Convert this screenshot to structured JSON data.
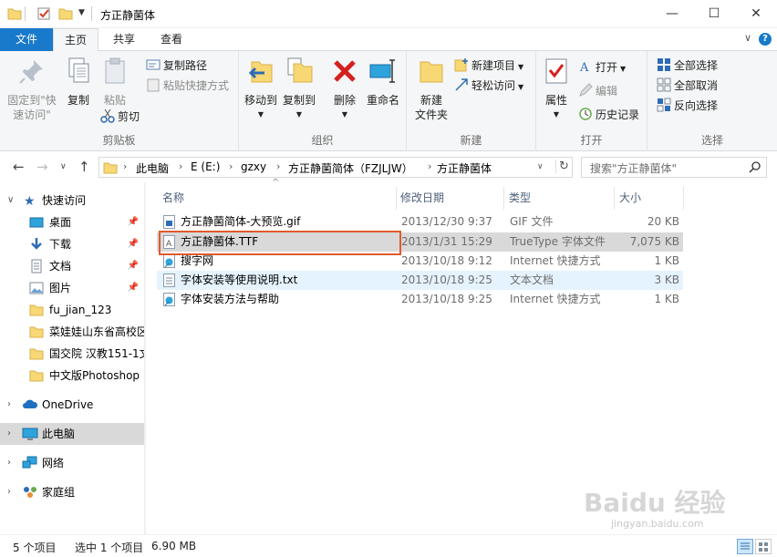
{
  "window": {
    "title": "方正静菌体",
    "controls": {
      "minimize": "—",
      "maximize": "☐",
      "close": "✕"
    }
  },
  "tabs": {
    "file": "文件",
    "home": "主页",
    "share": "共享",
    "view": "查看"
  },
  "ribbon": {
    "clipboard": {
      "label": "剪贴板",
      "pin": "固定到\"快速访问\"",
      "copy": "复制",
      "paste": "粘贴",
      "copy_path": "复制路径",
      "paste_shortcut": "粘贴快捷方式",
      "cut": "剪切"
    },
    "organize": {
      "label": "组织",
      "move_to": "移动到",
      "copy_to": "复制到",
      "delete": "删除",
      "rename": "重命名"
    },
    "new": {
      "label": "新建",
      "new_folder": "新建\n文件夹",
      "new_item": "新建项目",
      "easy_access": "轻松访问"
    },
    "open": {
      "label": "打开",
      "properties": "属性",
      "open": "打开",
      "edit": "编辑",
      "history": "历史记录"
    },
    "select": {
      "label": "选择",
      "select_all": "全部选择",
      "select_none": "全部取消",
      "invert": "反向选择"
    }
  },
  "address": {
    "crumbs": [
      "此电脑",
      "E (E:)",
      "gzxy",
      "方正静菌简体（FZJLJW）",
      "方正静菌体"
    ],
    "search_placeholder": "搜索\"方正静菌体\""
  },
  "nav": {
    "quick_access": "快速访问",
    "items": [
      {
        "label": "桌面",
        "pinned": true
      },
      {
        "label": "下载",
        "pinned": true
      },
      {
        "label": "文档",
        "pinned": true
      },
      {
        "label": "图片",
        "pinned": true
      },
      {
        "label": "fu_jian_123",
        "pinned": false
      },
      {
        "label": "菜娃娃山东省高校区",
        "pinned": false
      },
      {
        "label": "国交院 汉教151-1文",
        "pinned": false
      },
      {
        "label": "中文版Photoshop",
        "pinned": false
      }
    ],
    "onedrive": "OneDrive",
    "this_pc": "此电脑",
    "network": "网络",
    "homegroup": "家庭组"
  },
  "columns": {
    "name": "名称",
    "date": "修改日期",
    "type": "类型",
    "size": "大小"
  },
  "files": [
    {
      "name": "方正静菌简体-大预览.gif",
      "date": "2013/12/30 9:37",
      "type": "GIF 文件",
      "size": "20 KB",
      "icon": "gif-file-icon"
    },
    {
      "name": "方正静菌体.TTF",
      "date": "2013/1/31 15:29",
      "type": "TrueType 字体文件",
      "size": "7,075 KB",
      "icon": "font-file-icon"
    },
    {
      "name": "搜字网",
      "date": "2013/10/18 9:12",
      "type": "Internet 快捷方式",
      "size": "1 KB",
      "icon": "internet-shortcut-icon"
    },
    {
      "name": "字体安装等使用说明.txt",
      "date": "2013/10/18 9:25",
      "type": "文本文档",
      "size": "3 KB",
      "icon": "text-file-icon"
    },
    {
      "name": "字体安装方法与帮助",
      "date": "2013/10/18 9:25",
      "type": "Internet 快捷方式",
      "size": "1 KB",
      "icon": "internet-shortcut-icon"
    }
  ],
  "status": {
    "count": "5 个项目",
    "selected": "选中 1 个项目",
    "size": "6.90 MB"
  },
  "watermark": {
    "brand": "Baidu 经验",
    "url": "jingyan.baidu.com"
  }
}
